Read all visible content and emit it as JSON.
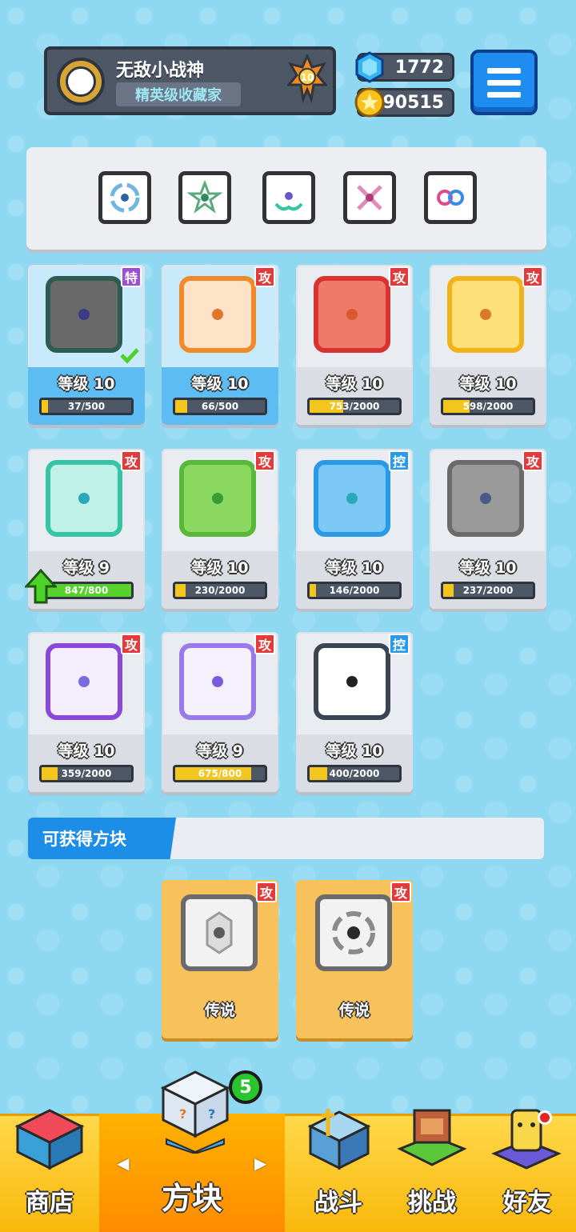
{
  "profile": {
    "name": "无敌小战神",
    "title": "精英级收藏家",
    "rank": "10"
  },
  "currency": {
    "gems": "1772",
    "coins": "90515"
  },
  "colors": {
    "attack_tag": "#e33b3b",
    "control_tag": "#2a9ae8",
    "special_tag": "#9b4fd6",
    "xp_fill": "#f3c61d",
    "upgrade_fill": "#57d12b"
  },
  "deck": [
    {
      "icon": "vortex-dice-icon",
      "color": "#3a6e9e"
    },
    {
      "icon": "star-dice-icon",
      "color": "#2c8b5e"
    },
    {
      "icon": "hands-dice-icon",
      "color": "#6b56c8"
    },
    {
      "icon": "cross-dice-icon",
      "color": "#b03a7a"
    },
    {
      "icon": "infinity-dice-icon",
      "color": "#d67a2a"
    }
  ],
  "cards": [
    {
      "tag": "特",
      "tag_type": "special",
      "level": "等级 10",
      "progress": "37/500",
      "fill": 0.074,
      "border": "#2e5c50",
      "bg": "#6a6a6a",
      "dot": "#3b3b8a",
      "selected": true,
      "icon": "healing-hands-dice-icon"
    },
    {
      "tag": "攻",
      "tag_type": "attack",
      "level": "等级 10",
      "progress": "66/500",
      "fill": 0.132,
      "border": "#f08a2a",
      "bg": "#fde3c8",
      "dot": "#e0762a",
      "selected": true,
      "icon": "bow-dice-icon"
    },
    {
      "tag": "攻",
      "tag_type": "attack",
      "level": "等级 10",
      "progress": "753/2000",
      "fill": 0.3765,
      "border": "#d83232",
      "bg": "#f07a6a",
      "dot": "#d85a2a",
      "selected": false,
      "icon": "fire-dice-icon"
    },
    {
      "tag": "攻",
      "tag_type": "attack",
      "level": "等级 10",
      "progress": "598/2000",
      "fill": 0.299,
      "border": "#f2b21a",
      "bg": "#fde07a",
      "dot": "#d87a2a",
      "selected": false,
      "icon": "electric-dice-icon"
    },
    {
      "tag": "攻",
      "tag_type": "attack",
      "level": "等级 9",
      "progress": "847/800",
      "fill": 1.0,
      "border": "#35c4a6",
      "bg": "#bff1e6",
      "dot": "#2aa8b8",
      "selected": false,
      "upgrade": true,
      "icon": "wind-dice-icon"
    },
    {
      "tag": "攻",
      "tag_type": "attack",
      "level": "等级 10",
      "progress": "230/2000",
      "fill": 0.115,
      "border": "#58b83a",
      "bg": "#8ad860",
      "dot": "#3a9a3a",
      "selected": false,
      "icon": "poison-dice-icon"
    },
    {
      "tag": "控",
      "tag_type": "control",
      "level": "等级 10",
      "progress": "146/2000",
      "fill": 0.073,
      "border": "#2a9ae8",
      "bg": "#7cc8f6",
      "dot": "#2aa8b8",
      "selected": false,
      "icon": "ice-dice-icon"
    },
    {
      "tag": "攻",
      "tag_type": "attack",
      "level": "等级 10",
      "progress": "237/2000",
      "fill": 0.1185,
      "border": "#6b6b6b",
      "bg": "#9a9a9a",
      "dot": "#4a5a8a",
      "selected": false,
      "icon": "gear-dice-icon"
    },
    {
      "tag": "攻",
      "tag_type": "attack",
      "level": "等级 10",
      "progress": "359/2000",
      "fill": 0.1795,
      "border": "#8a48d8",
      "bg": "#f4eefc",
      "dot": "#7a6ae0",
      "selected": false,
      "icon": "arrows-dice-icon"
    },
    {
      "tag": "攻",
      "tag_type": "attack",
      "level": "等级 9",
      "progress": "675/800",
      "fill": 0.844,
      "border": "#9a7ae8",
      "bg": "#f4f0fc",
      "dot": "#7a5ae0",
      "selected": false,
      "icon": "mystery-dice-icon"
    },
    {
      "tag": "控",
      "tag_type": "control",
      "level": "等级 10",
      "progress": "400/2000",
      "fill": 0.2,
      "border": "#3a4452",
      "bg": "#ffffff",
      "dot": "#222222",
      "selected": false,
      "icon": "lock-dice-icon"
    }
  ],
  "obtainable": {
    "title": "可获得方块",
    "items": [
      {
        "tag": "攻",
        "label": "传说",
        "icon": "dragon-crest-dice-icon"
      },
      {
        "tag": "攻",
        "label": "传说",
        "icon": "dragon-vortex-dice-icon"
      }
    ]
  },
  "nav": {
    "shop": "商店",
    "dice": "方块",
    "battle": "战斗",
    "challenge": "挑战",
    "friends": "好友",
    "dice_badge": "5"
  }
}
